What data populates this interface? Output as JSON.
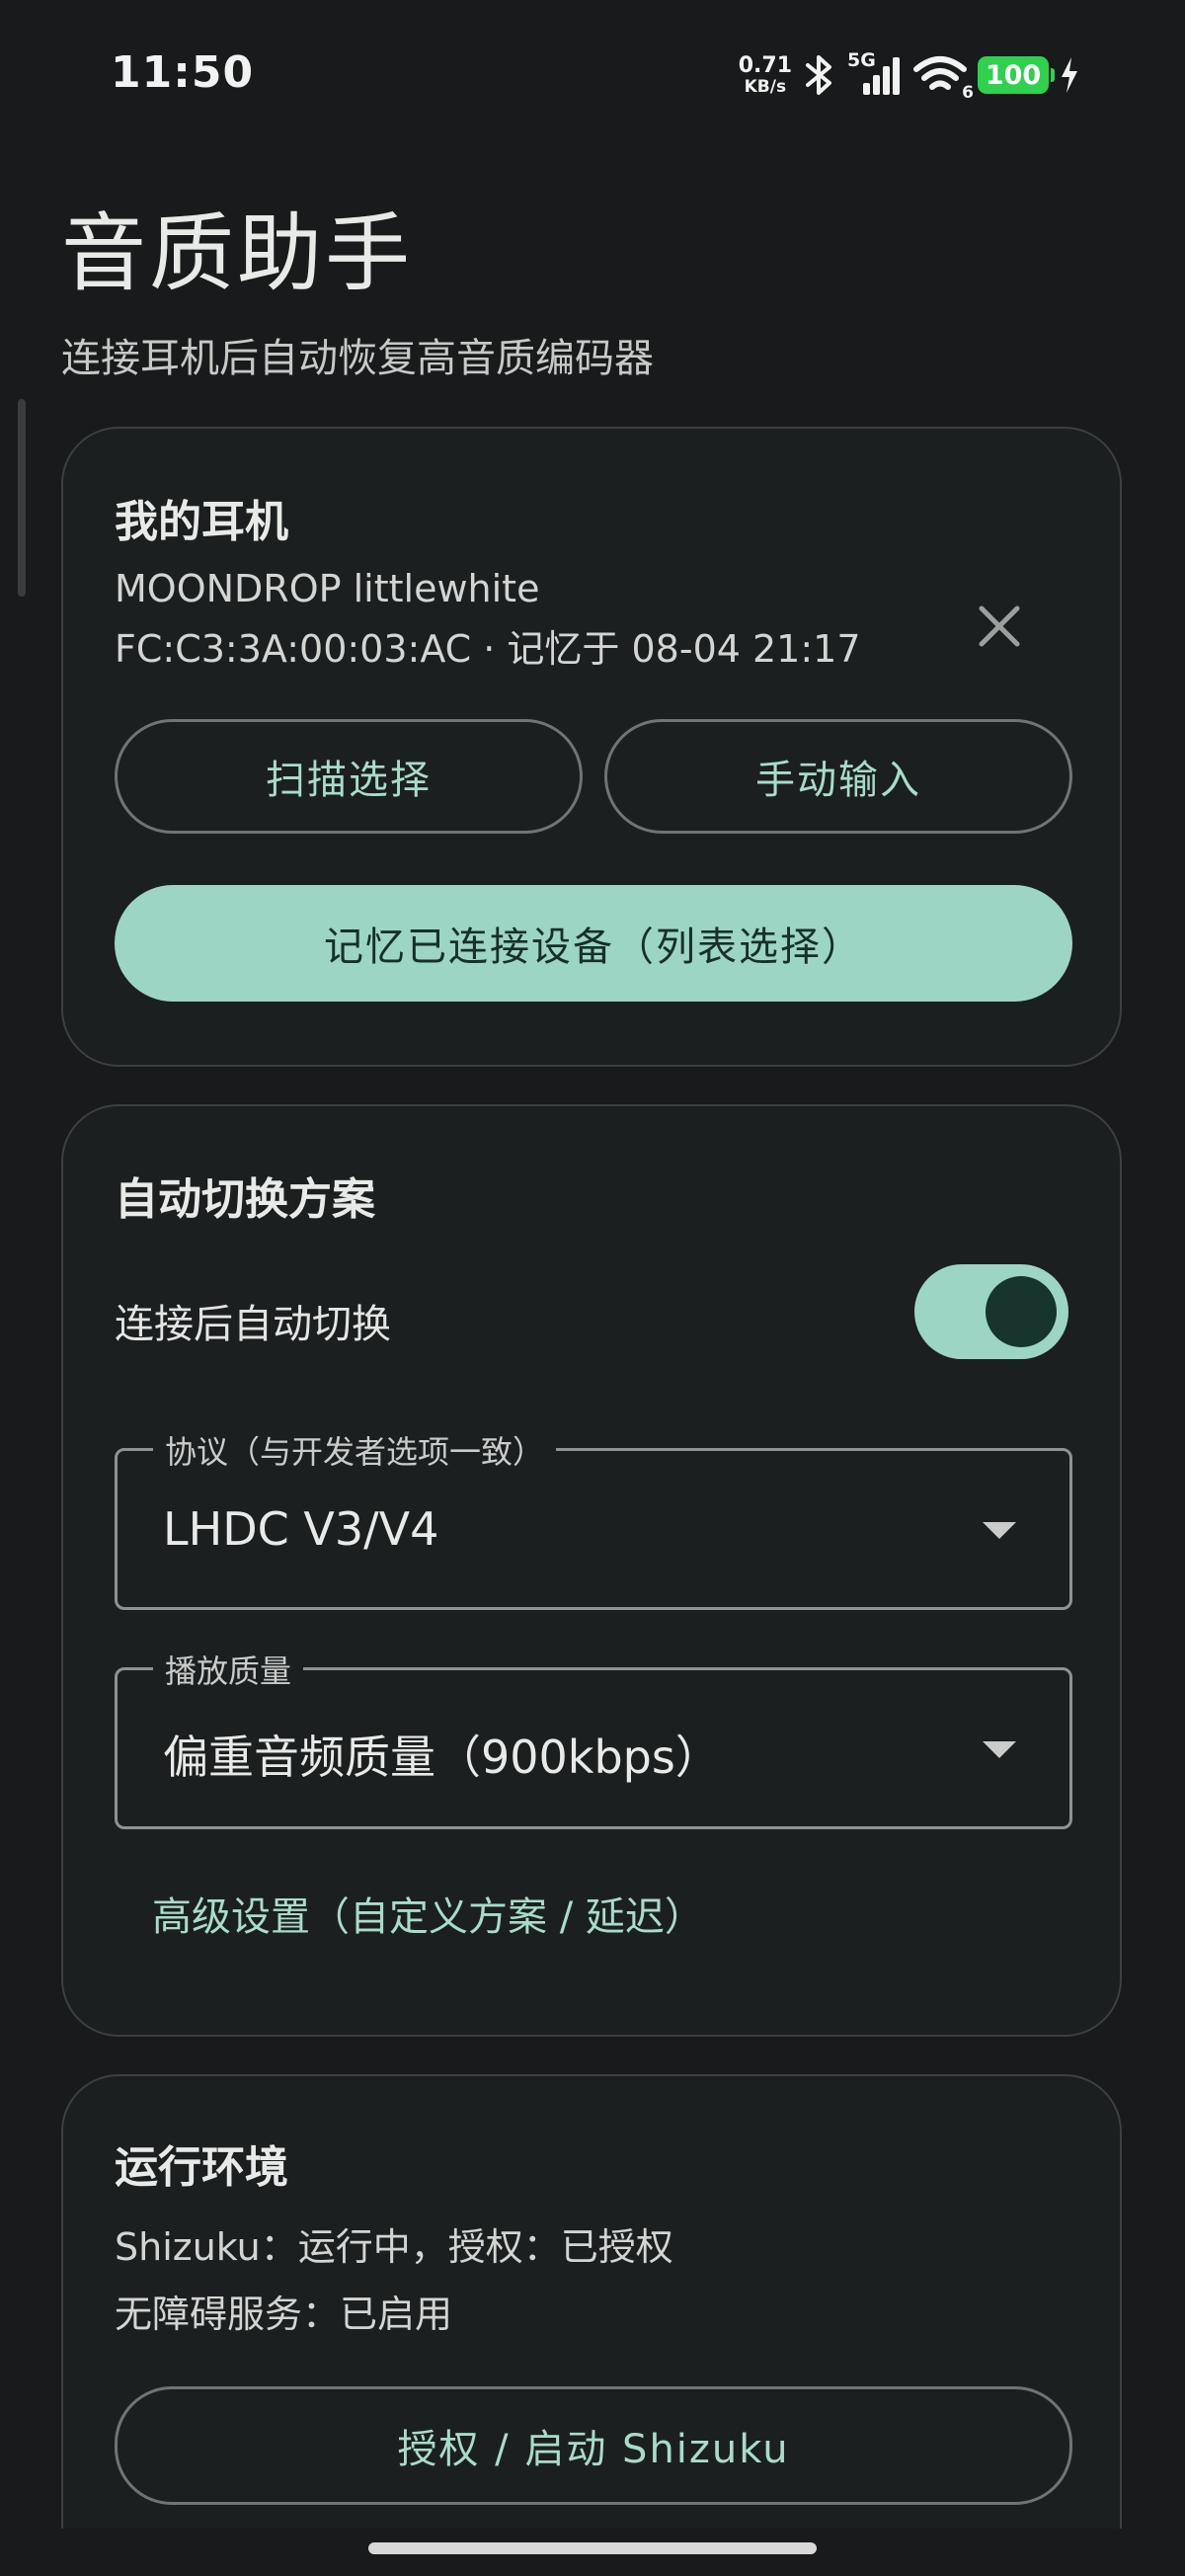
{
  "status_bar": {
    "time": "11:50",
    "net_speed_value": "0.71",
    "net_speed_unit": "KB/s",
    "network_type": "5G",
    "wifi_badge": "6",
    "battery_level": "100",
    "bluetooth_icon": "bluetooth-icon",
    "signal_icon": "cellular-signal-icon",
    "wifi_icon": "wifi-icon",
    "charging_icon": "lightning-icon"
  },
  "header": {
    "title": "音质助手",
    "subtitle": "连接耳机后自动恢复高音质编码器"
  },
  "my_headphones": {
    "title": "我的耳机",
    "device_name": "MOONDROP littlewhite",
    "device_detail": "FC:C3:3A:00:03:AC · 记忆于 08-04 21:17",
    "scan_button": "扫描选择",
    "manual_button": "手动输入",
    "remembered_button": "记忆已连接设备（列表选择）"
  },
  "auto_switch": {
    "title": "自动切换方案",
    "toggle_label": "连接后自动切换",
    "toggle_on": true,
    "protocol_label": "协议（与开发者选项一致）",
    "protocol_value": "LHDC V3/V4",
    "quality_label": "播放质量",
    "quality_value": "偏重音频质量（900kbps）",
    "advanced_link": "高级设置（自定义方案 / 延迟）"
  },
  "runtime": {
    "title": "运行环境",
    "shizuku_status": "Shizuku：运行中，授权：已授权",
    "accessibility_status": "无障碍服务：已启用",
    "shizuku_button": "授权 / 启动 Shizuku"
  },
  "colors": {
    "background": "#181a1b",
    "accent": "#9dd5c5",
    "accent_text": "#a8dcc9",
    "battery": "#2fd14f"
  }
}
